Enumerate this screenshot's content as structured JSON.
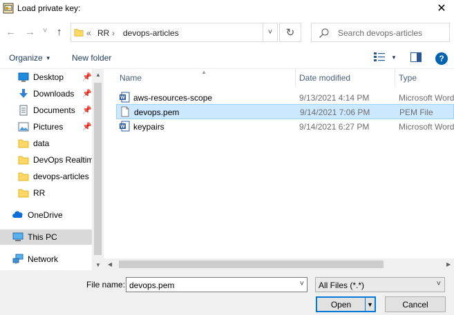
{
  "window": {
    "title": "Load private key:"
  },
  "nav": {
    "back": "←",
    "forward": "→",
    "history": "˅",
    "up": "↑",
    "path_prefix": "«",
    "breadcrumb": [
      "RR",
      "devops-articles"
    ],
    "separator": "›",
    "refresh": "↻",
    "address_dropdown": "˅",
    "search_placeholder": "Search devops-articles"
  },
  "toolbar": {
    "organize_label": "Organize",
    "new_folder_label": "New folder",
    "help": "?"
  },
  "sidebar": {
    "items": [
      {
        "label": "Desktop",
        "icon": "desktop-icon",
        "pinned": true
      },
      {
        "label": "Downloads",
        "icon": "downloads-icon",
        "pinned": true
      },
      {
        "label": "Documents",
        "icon": "documents-icon",
        "pinned": true
      },
      {
        "label": "Pictures",
        "icon": "pictures-icon",
        "pinned": true
      },
      {
        "label": "data",
        "icon": "folder-icon",
        "pinned": false
      },
      {
        "label": "DevOps Realtime",
        "icon": "folder-icon",
        "pinned": false
      },
      {
        "label": "devops-articles",
        "icon": "folder-icon",
        "pinned": false
      },
      {
        "label": "RR",
        "icon": "folder-icon",
        "pinned": false
      }
    ],
    "onedrive": "OneDrive",
    "this_pc": "This PC",
    "network": "Network",
    "pin_glyph": "📌"
  },
  "columns": {
    "name": "Name",
    "date": "Date modified",
    "type": "Type"
  },
  "files": [
    {
      "name": "aws-resources-scope",
      "date": "9/13/2021 4:14 PM",
      "type": "Microsoft Word D",
      "icon": "word-doc-icon",
      "selected": false
    },
    {
      "name": "devops.pem",
      "date": "9/14/2021 7:06 PM",
      "type": "PEM File",
      "icon": "file-icon",
      "selected": true
    },
    {
      "name": "keypairs",
      "date": "9/14/2021 6:27 PM",
      "type": "Microsoft Word D",
      "icon": "word-doc-icon",
      "selected": false
    }
  ],
  "footer": {
    "filename_label": "File name:",
    "filename_value": "devops.pem",
    "filter_value": "All Files (*.*)",
    "open_label": "Open",
    "cancel_label": "Cancel"
  },
  "colors": {
    "accent": "#0078d7",
    "selection": "#cce8ff",
    "folder": "#ffd866"
  }
}
